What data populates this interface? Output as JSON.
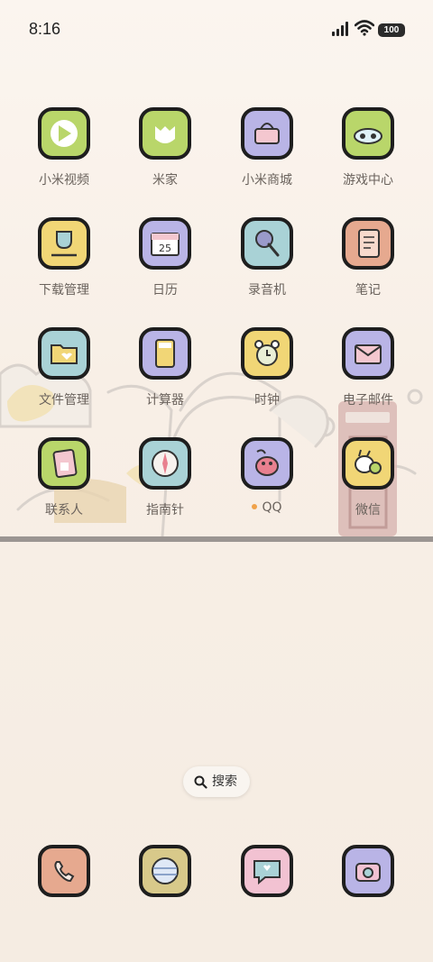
{
  "status_bar": {
    "time": "8:16",
    "battery": "100"
  },
  "apps": [
    {
      "label": "小米视频",
      "color": "#b9d66a",
      "icon": "play-icon"
    },
    {
      "label": "米家",
      "color": "#b9d66a",
      "icon": "mijia-cat-icon"
    },
    {
      "label": "小米商城",
      "color": "#b9b4e6",
      "icon": "basket-icon"
    },
    {
      "label": "游戏中心",
      "color": "#b9d66a",
      "icon": "game-mask-icon"
    },
    {
      "label": "下载管理",
      "color": "#f1d676",
      "icon": "download-icon"
    },
    {
      "label": "日历",
      "color": "#b9b4e6",
      "icon": "calendar-icon",
      "date": "25"
    },
    {
      "label": "录音机",
      "color": "#a9d2d6",
      "icon": "microphone-icon"
    },
    {
      "label": "笔记",
      "color": "#e6a98f",
      "icon": "notebook-icon"
    },
    {
      "label": "文件管理",
      "color": "#a9d2d6",
      "icon": "folder-icon"
    },
    {
      "label": "计算器",
      "color": "#b9b4e6",
      "icon": "calculator-icon"
    },
    {
      "label": "时钟",
      "color": "#f1d676",
      "icon": "alarm-clock-icon"
    },
    {
      "label": "电子邮件",
      "color": "#b9b4e6",
      "icon": "envelope-icon"
    },
    {
      "label": "联系人",
      "color": "#b9d66a",
      "icon": "contacts-card-icon"
    },
    {
      "label": "指南针",
      "color": "#a9d2d6",
      "icon": "compass-icon"
    },
    {
      "label": "QQ",
      "color": "#b9b4e6",
      "icon": "qq-penguin-icon"
    },
    {
      "label": "微信",
      "color": "#f1d676",
      "icon": "wechat-bunny-icon"
    }
  ],
  "search": {
    "label": "搜索"
  },
  "dock": [
    {
      "name": "phone",
      "color": "#e6a98f",
      "icon": "phone-icon"
    },
    {
      "name": "browser",
      "color": "#d8c98a",
      "icon": "globe-icon"
    },
    {
      "name": "messages",
      "color": "#f2c2d2",
      "icon": "chat-bubble-icon"
    },
    {
      "name": "camera",
      "color": "#b9b4e6",
      "icon": "camera-icon"
    }
  ]
}
